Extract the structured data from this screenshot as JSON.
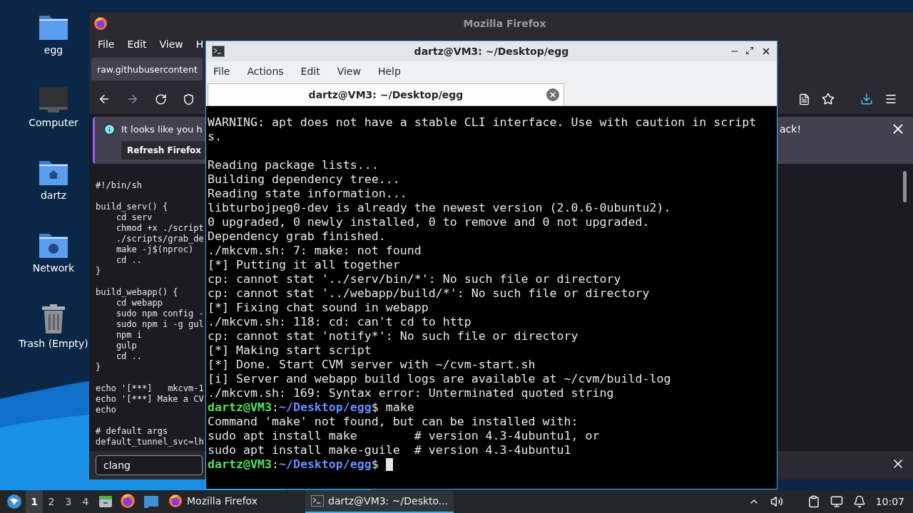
{
  "desktop_icons": [
    {
      "label": "egg",
      "kind": "folder"
    },
    {
      "label": "Computer",
      "kind": "computer"
    },
    {
      "label": "dartz",
      "kind": "home"
    },
    {
      "label": "Network",
      "kind": "network"
    },
    {
      "label": "Trash (Empty)",
      "kind": "trash"
    }
  ],
  "firefox": {
    "title": "Mozilla Firefox",
    "menu": [
      "File",
      "Edit",
      "View",
      "H"
    ],
    "url": "raw.githubusercontent",
    "notification": {
      "text": "It looks like you h",
      "text_end": "ack!",
      "button": "Refresh Firefox"
    },
    "code_blocks": [
      [
        "#!/bin/sh"
      ],
      [
        "build_serv() {",
        "    cd serv",
        "    chmod +x ./script",
        "    ./scripts/grab_de",
        "    make -j$(nproc)",
        "    cd ..",
        "}"
      ],
      [
        "build_webapp() {",
        "    cd webapp",
        "    sudo npm config -",
        "    sudo npm i -g gul",
        "    npm i",
        "    gulp",
        "    cd ..",
        "}"
      ],
      [
        "echo '[***]   mkcvm-1",
        "echo '[***] Make a CV",
        "echo"
      ],
      [
        "# default args",
        "default_tunnel_svc=lh"
      ]
    ],
    "find": {
      "value": "clang"
    }
  },
  "terminal": {
    "title": "dartz@VM3: ~/Desktop/egg",
    "menu": [
      "File",
      "Actions",
      "Edit",
      "View",
      "Help"
    ],
    "tab": {
      "label": "dartz@VM3: ~/Desktop/egg",
      "selected": true
    },
    "lines": [
      {
        "kind": "output",
        "text": "WARNING: apt does not have a stable CLI interface. Use with caution in script"
      },
      {
        "kind": "output",
        "text": "s."
      },
      {
        "kind": "blank"
      },
      {
        "kind": "output",
        "text": "Reading package lists..."
      },
      {
        "kind": "output",
        "text": "Building dependency tree..."
      },
      {
        "kind": "output",
        "text": "Reading state information..."
      },
      {
        "kind": "output",
        "text": "libturbojpeg0-dev is already the newest version (2.0.6-0ubuntu2)."
      },
      {
        "kind": "output",
        "text": "0 upgraded, 0 newly installed, 0 to remove and 0 not upgraded."
      },
      {
        "kind": "output",
        "text": "Dependency grab finished."
      },
      {
        "kind": "output",
        "text": "./mkcvm.sh: 7: make: not found"
      },
      {
        "kind": "output",
        "text": "[*] Putting it all together"
      },
      {
        "kind": "output",
        "text": "cp: cannot stat '../serv/bin/*': No such file or directory"
      },
      {
        "kind": "output",
        "text": "cp: cannot stat '../webapp/build/*': No such file or directory"
      },
      {
        "kind": "output",
        "text": "[*] Fixing chat sound in webapp"
      },
      {
        "kind": "output",
        "text": "./mkcvm.sh: 118: cd: can't cd to http"
      },
      {
        "kind": "output",
        "text": "cp: cannot stat 'notify*': No such file or directory"
      },
      {
        "kind": "output",
        "text": "[*] Making start script"
      },
      {
        "kind": "output",
        "text": "[*] Done. Start CVM server with ~/cvm-start.sh"
      },
      {
        "kind": "output",
        "text": "[i] Server and webapp build logs are available at ~/cvm/build-log"
      },
      {
        "kind": "output",
        "text": "./mkcvm.sh: 169: Syntax error: Unterminated quoted string"
      },
      {
        "kind": "prompt",
        "user": "dartz@VM3",
        "sep": ":",
        "path": "~/Desktop/egg",
        "symbol": "$",
        "command": "make"
      },
      {
        "kind": "output",
        "text": "Command 'make' not found, but can be installed with:"
      },
      {
        "kind": "output",
        "text": "sudo apt install make        # version 4.3-4ubuntu1, or"
      },
      {
        "kind": "output",
        "text": "sudo apt install make-guile  # version 4.3-4ubuntu1"
      },
      {
        "kind": "prompt",
        "user": "dartz@VM3",
        "sep": ":",
        "path": "~/Desktop/egg",
        "symbol": "$",
        "cursor": true
      }
    ]
  },
  "taskbar": {
    "workspaces": [
      {
        "label": "1",
        "selected": true
      },
      {
        "label": "2",
        "selected": false
      },
      {
        "label": "3",
        "selected": false
      },
      {
        "label": "4",
        "selected": false
      }
    ],
    "tasks": [
      {
        "label": "Mozilla Firefox",
        "kind": "browser",
        "selected": false
      },
      {
        "label": "dartz@VM3: ~/Deskto...",
        "kind": "terminal",
        "selected": true
      }
    ],
    "clock": "10:07"
  }
}
